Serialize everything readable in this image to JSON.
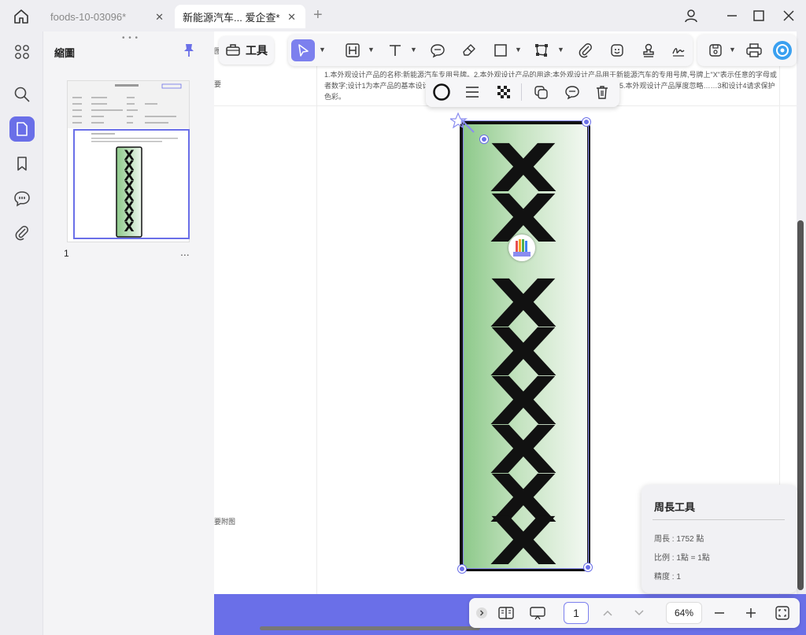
{
  "tabs": [
    {
      "label": "foods-10-03096*",
      "active": false
    },
    {
      "label": "新能源汽车... 爱企查*",
      "active": true
    }
  ],
  "thumbnails": {
    "title": "縮圖",
    "page_number": "1",
    "more": "..."
  },
  "toolbar": {
    "tools_label": "工具"
  },
  "document": {
    "body_text": "1.本外观设计产品的名称:新能源汽车专用号牌。2.本外观设计产品的用途:本外观设计产品用于新能源汽车的专用号牌,号牌上\"X\"表示任意的字母或者数字;设计1为本产品的基本设计……影表明本外观设计设计要点的图片或照片:设计1主视图。5.本外观设计产品厚度忽略……3和设计4请求保护色彩。",
    "left_label_top": "要",
    "left_label_bottom": "要附图",
    "left_label_corner": "图",
    "plate_glyphs": [
      "X",
      "X",
      "X",
      "X",
      "X",
      "X",
      "X",
      "X",
      "X"
    ]
  },
  "measure_panel": {
    "title": "周長工具",
    "perimeter": "周長 : 1752 點",
    "scale": "比例 : 1點 = 1點",
    "precision": "精度 : 1"
  },
  "bottom_bar": {
    "page": "1",
    "zoom": "64%"
  },
  "colors": {
    "accent": "#6a6fe8",
    "plate_green": "#8dc98a"
  }
}
